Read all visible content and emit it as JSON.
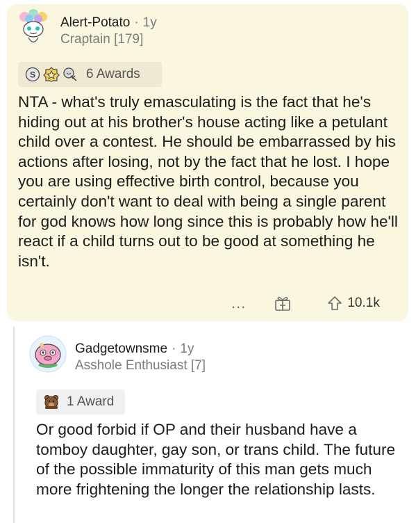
{
  "comments": [
    {
      "username": "Alert-Potato",
      "age": "1y",
      "flair": "Craptain [179]",
      "awards_label": "6 Awards",
      "text": "NTA - what's truly emasculating is the fact that he's hiding out at his brother's house acting like a petulant child over a contest. He should be embarrassed by his actions after losing, not by the fact that he lost. I hope you are using effective birth control, because you certainly don't want to deal with being a single parent for god knows how long since this is probably how he'll react if a child turns out to be good at something he isn't.",
      "more": "...",
      "upvotes": "10.1k"
    },
    {
      "username": "Gadgetownsme",
      "age": "1y",
      "flair": "Asshole Enthusiast [7]",
      "awards_label": "1 Award",
      "text": "Or good forbid if OP and their husband have a tomboy daughter, gay son, or trans child. The future of the possible immaturity of this man gets much more frightening the longer the relationship lasts."
    }
  ],
  "separator": "·",
  "icons": [
    "snoo-avatar-icon",
    "silver-award-icon",
    "gold-award-icon",
    "helpful-award-icon",
    "more-icon",
    "gift-icon",
    "upvote-icon",
    "pink-snoo-avatar-icon",
    "bear-award-icon"
  ],
  "colors": {
    "highlight_bg": "#fbf6df",
    "muted_text": "#7c7c7c",
    "award_pill": "#efe9d3"
  }
}
